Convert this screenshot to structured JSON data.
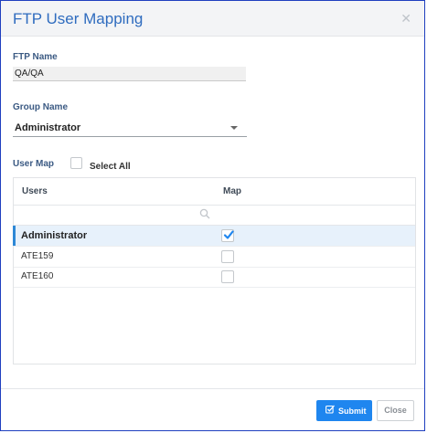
{
  "dialog": {
    "title": "FTP User Mapping",
    "close_icon": "close-icon"
  },
  "form": {
    "ftp_name_label": "FTP Name",
    "ftp_name_value": "QA/QA",
    "group_name_label": "Group Name",
    "group_name_value": "Administrator",
    "user_map_label": "User Map",
    "select_all_label": "Select All",
    "select_all_checked": false
  },
  "grid": {
    "columns": [
      "Users",
      "Map"
    ],
    "filter_placeholder": "",
    "rows": [
      {
        "user": "Administrator",
        "mapped": true,
        "selected": true
      },
      {
        "user": "ATE159",
        "mapped": false,
        "selected": false
      },
      {
        "user": "ATE160",
        "mapped": false,
        "selected": false
      }
    ]
  },
  "buttons": {
    "submit_label": "Submit",
    "close_label": "Close"
  },
  "colors": {
    "title": "#2f6cbf",
    "accent": "#2e88d6",
    "submit_bg": "#1f86ef",
    "selected_row_bg": "#e7f1fb",
    "frame_border": "#1f3fbf"
  }
}
